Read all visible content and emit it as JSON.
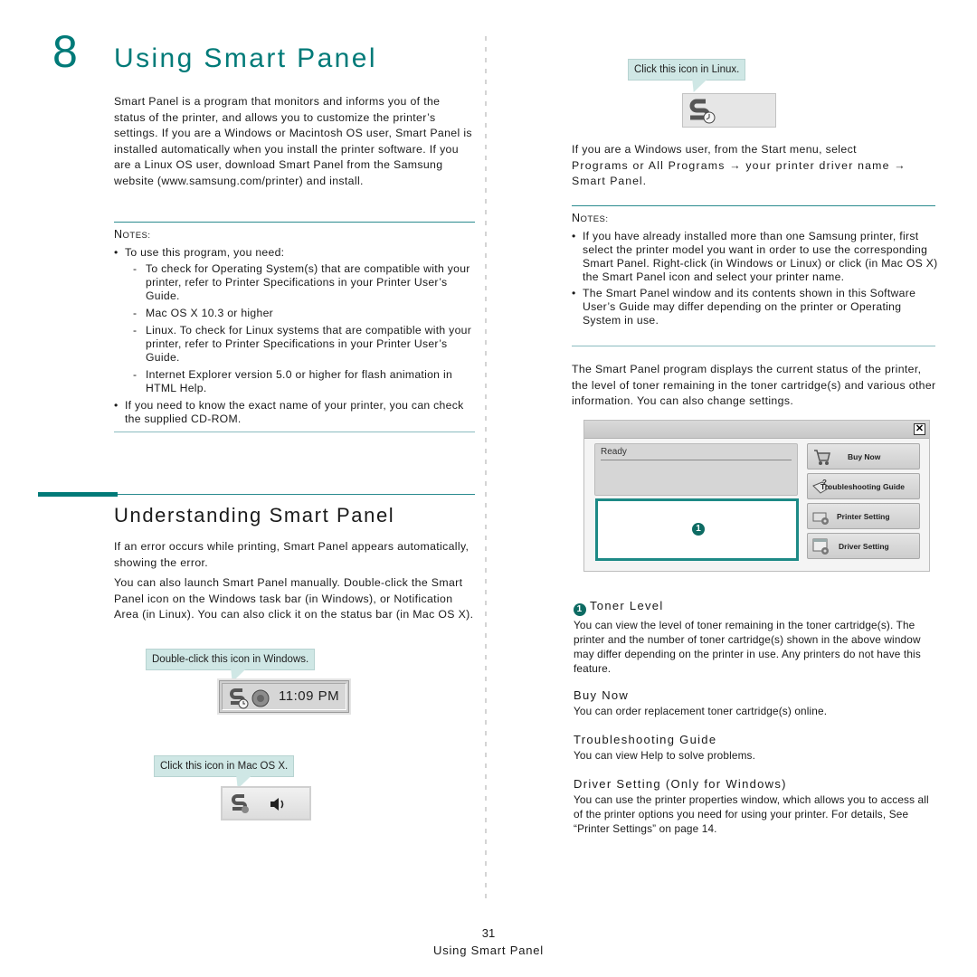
{
  "chapter": {
    "number": "8",
    "title": "Using Smart Panel"
  },
  "intro": "Smart Panel is a program that monitors and informs you of the status of the printer, and allows you to customize the printer’s settings. If you are a Windows or Macintosh OS user, Smart Panel is installed automatically when you install the printer software. If you are a Linux OS user, download Smart Panel from the Samsung website (www.samsung.com/printer) and install.",
  "notes_left": {
    "label_cap": "N",
    "label_rest": "OTES:",
    "items": [
      {
        "text": "To use this program, you need:",
        "sub": [
          "To check for Operating System(s) that are compatible with your printer, refer to Printer Specifications in your Printer User’s Guide.",
          "Mac OS X 10.3 or higher",
          "Linux. To check for Linux systems that are compatible with your printer, refer to Printer Specifications in your Printer User’s Guide.",
          "Internet Explorer version 5.0 or higher for flash animation in HTML Help."
        ]
      },
      {
        "text": "If you need to know the exact name of your printer, you can check the supplied CD-ROM."
      }
    ]
  },
  "section": {
    "title": "Understanding Smart Panel",
    "para1": "If an error occurs while printing, Smart Panel appears automatically, showing the error.",
    "para2": "You can also launch Smart Panel manually. Double-click the Smart Panel icon on the Windows task bar (in Windows), or Notification Area (in Linux). You can also click it on the status bar (in Mac OS X)."
  },
  "callouts": {
    "windows": "Double-click this icon in Windows.",
    "mac": "Click this icon in Mac OS X.",
    "linux": "Click this icon in Linux."
  },
  "tray": {
    "windows_clock": "11:09 PM"
  },
  "start_menu": {
    "line1": "If you are a Windows user, from the Start menu, select",
    "line2_a": "Programs or All Programs",
    "arrow": "→",
    "line2_b": "your printer driver name",
    "line3": "Smart Panel."
  },
  "notes_right": {
    "label_cap": "N",
    "label_rest": "OTES:",
    "items": [
      "If you have already installed more than one Samsung printer, first select the printer model you want in order to use the corresponding Smart Panel. Right-click (in Windows or Linux) or click (in Mac OS X) the Smart Panel icon and select your printer name.",
      "The Smart Panel window and its contents shown in this Software User’s Guide may differ depending on the printer or Operating System in use."
    ]
  },
  "display_para": "The Smart Panel program displays the current status of the printer, the level of toner remaining in the toner cartridge(s) and various other information. You can also change settings.",
  "smart_panel_window": {
    "close_glyph": "✕",
    "status": "Ready",
    "toner_badge": "1",
    "buttons": [
      {
        "label": "Buy Now",
        "icon": "shopping-cart-icon"
      },
      {
        "label": "Troubleshooting Guide",
        "icon": "help-book-icon"
      },
      {
        "label": "Printer Setting",
        "icon": "printer-gear-icon"
      },
      {
        "label": "Driver Setting",
        "icon": "window-gear-icon"
      }
    ]
  },
  "definitions": [
    {
      "badge": "1",
      "title": "Toner Level",
      "text": "You can view the level of toner remaining in the toner cartridge(s). The printer and the number of toner cartridge(s) shown in the above window may differ depending on the printer in use. Any printers do not have this feature."
    },
    {
      "title": "Buy Now",
      "text": "You can order replacement toner cartridge(s) online."
    },
    {
      "title": "Troubleshooting Guide",
      "text": "You can view Help to solve problems."
    },
    {
      "title": "Driver Setting (Only for Windows)",
      "text": "You can use the printer properties window, which allows you to access all of the printer options you need for using your printer. For details, See “Printer Settings” on page 14."
    }
  ],
  "footer": {
    "page_number": "31",
    "title": "Using Smart Panel"
  },
  "colors": {
    "accent": "#007a78",
    "callout_bg": "#cfe7e5",
    "rule": "#2a8b8f"
  }
}
